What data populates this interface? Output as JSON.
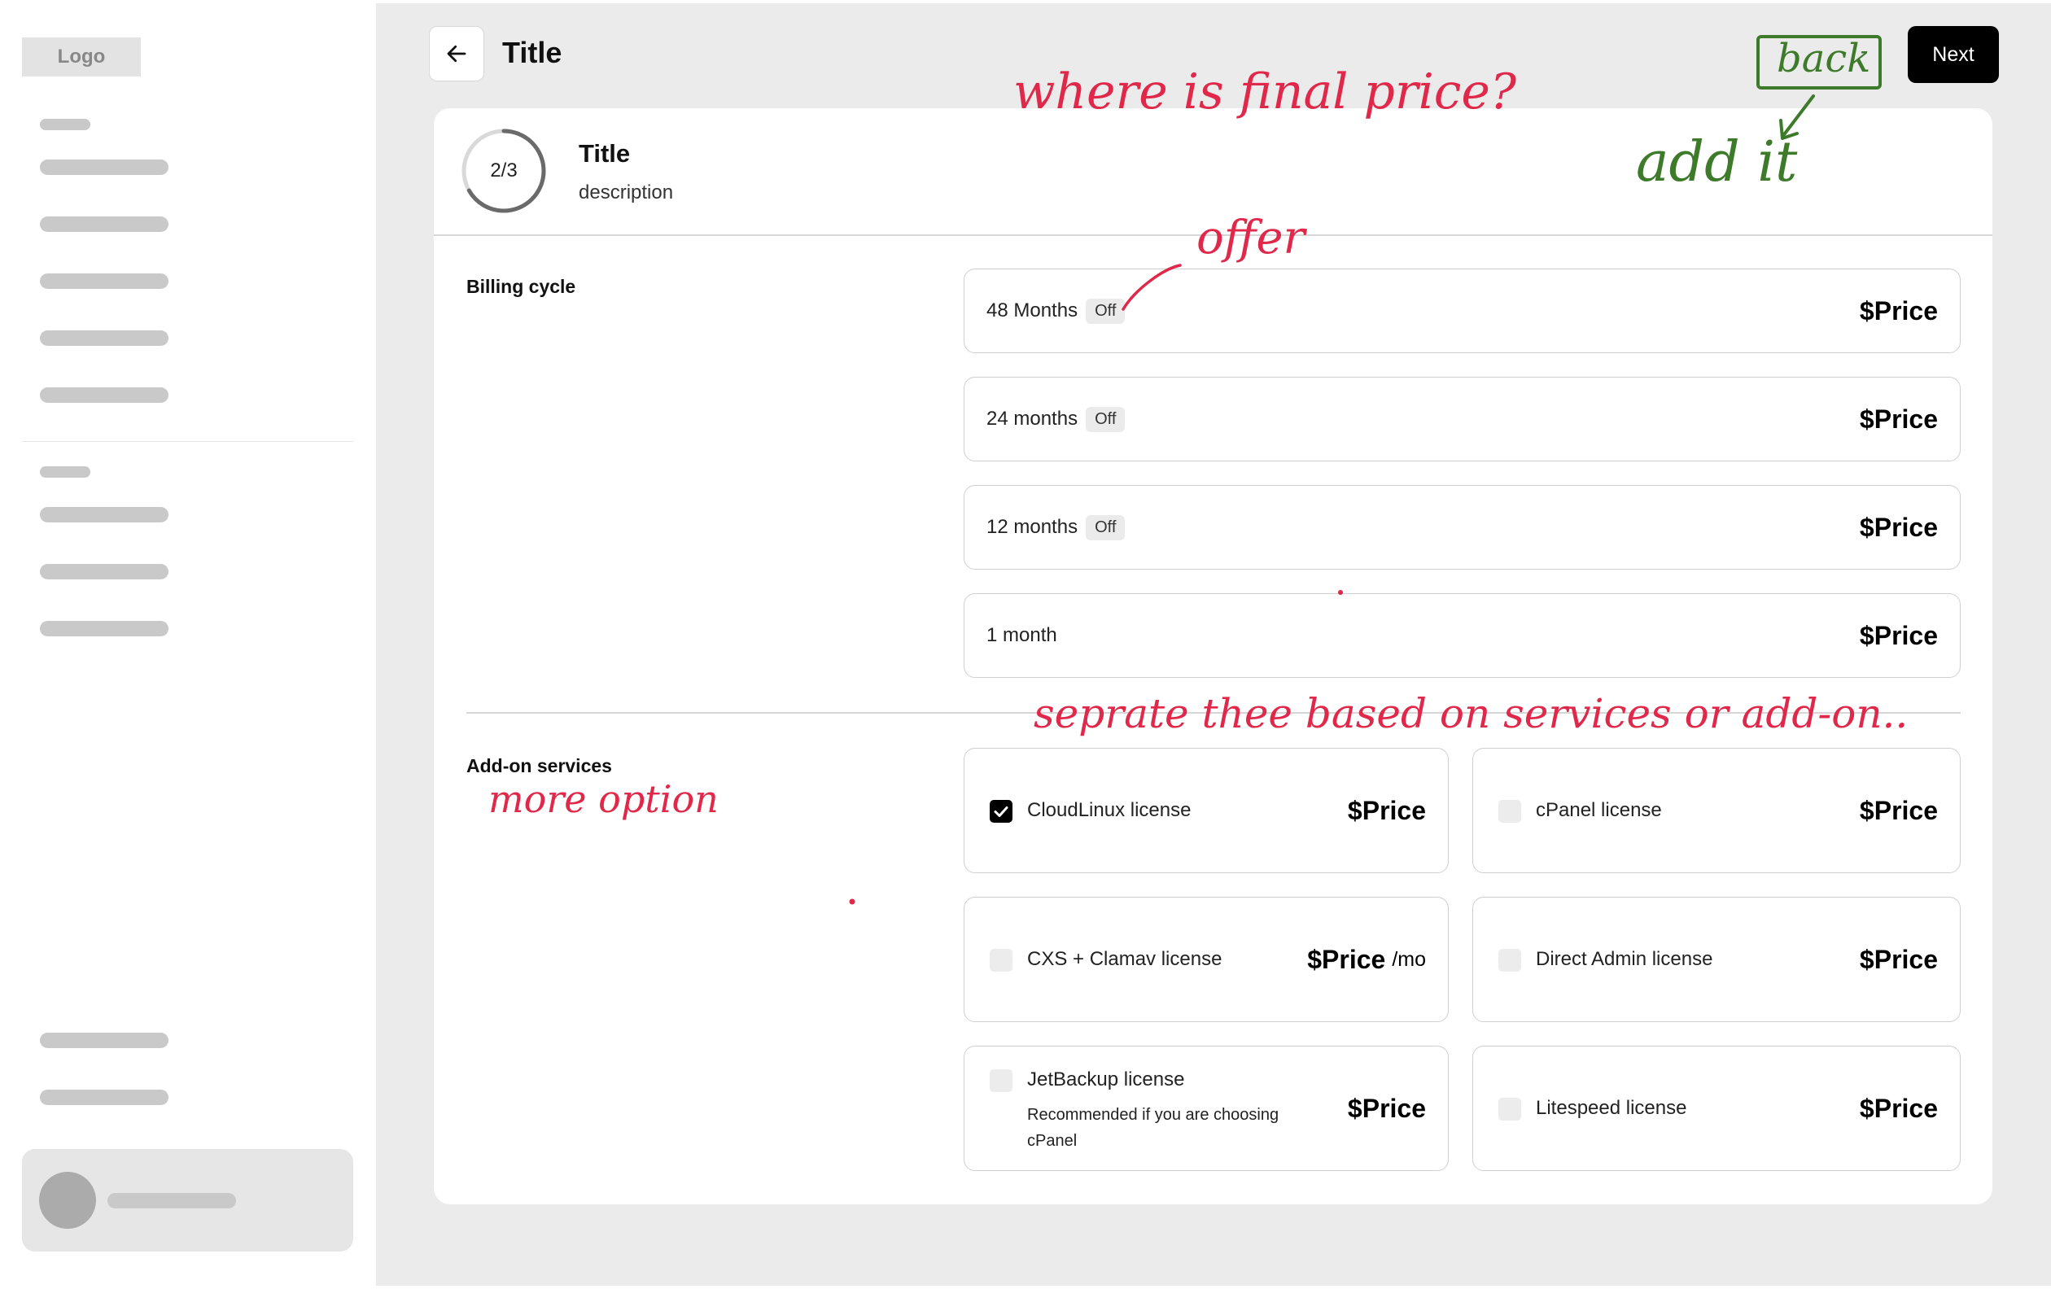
{
  "sidebar": {
    "logo_text": "Logo"
  },
  "header": {
    "title": "Title",
    "next_label": "Next"
  },
  "step": {
    "progress_text": "2/3",
    "progress_fraction": 0.667,
    "title": "Title",
    "description": "description"
  },
  "billing": {
    "label": "Billing cycle",
    "options": [
      {
        "name": "48 Months",
        "badge": "Off",
        "price": "$Price"
      },
      {
        "name": "24 months",
        "badge": "Off",
        "price": "$Price"
      },
      {
        "name": "12 months",
        "badge": "Off",
        "price": "$Price"
      },
      {
        "name": "1 month",
        "price": "$Price"
      }
    ]
  },
  "addons": {
    "label": "Add-on services",
    "options": [
      {
        "name": "CloudLinux license",
        "price": "$Price",
        "checked": true
      },
      {
        "name": "cPanel license",
        "price": "$Price",
        "checked": false
      },
      {
        "name": "CXS + Clamav license",
        "price": "$Price",
        "suffix": "/mo",
        "checked": false
      },
      {
        "name": "Direct Admin license",
        "price": "$Price",
        "checked": false
      },
      {
        "name": "JetBackup license",
        "subtext_line1": "Recommended if you are choosing",
        "subtext_line2": "cPanel",
        "price": "$Price",
        "checked": false
      },
      {
        "name": "Litespeed license",
        "price": "$Price",
        "checked": false
      }
    ]
  },
  "annotations": {
    "final_price": "where is final price?",
    "back": "back",
    "add_it": "add it",
    "offer": "offer",
    "separate": "seprate thee based on services or add-on..",
    "more_option": "more option"
  },
  "colors": {
    "annotation_red": "#e0284a",
    "annotation_green": "#3d7a2a",
    "primary_button": "#000000",
    "main_background": "#ebebeb"
  }
}
